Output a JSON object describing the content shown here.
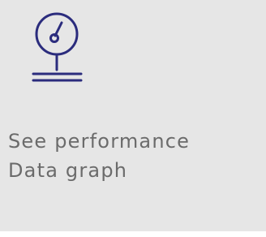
{
  "card": {
    "line1": "See performance",
    "line2": "Data graph",
    "icon": "gauge-meter-icon",
    "colors": {
      "background": "#e6e6e6",
      "icon": "#2b2c7d",
      "text": "#6b6b6b"
    }
  }
}
